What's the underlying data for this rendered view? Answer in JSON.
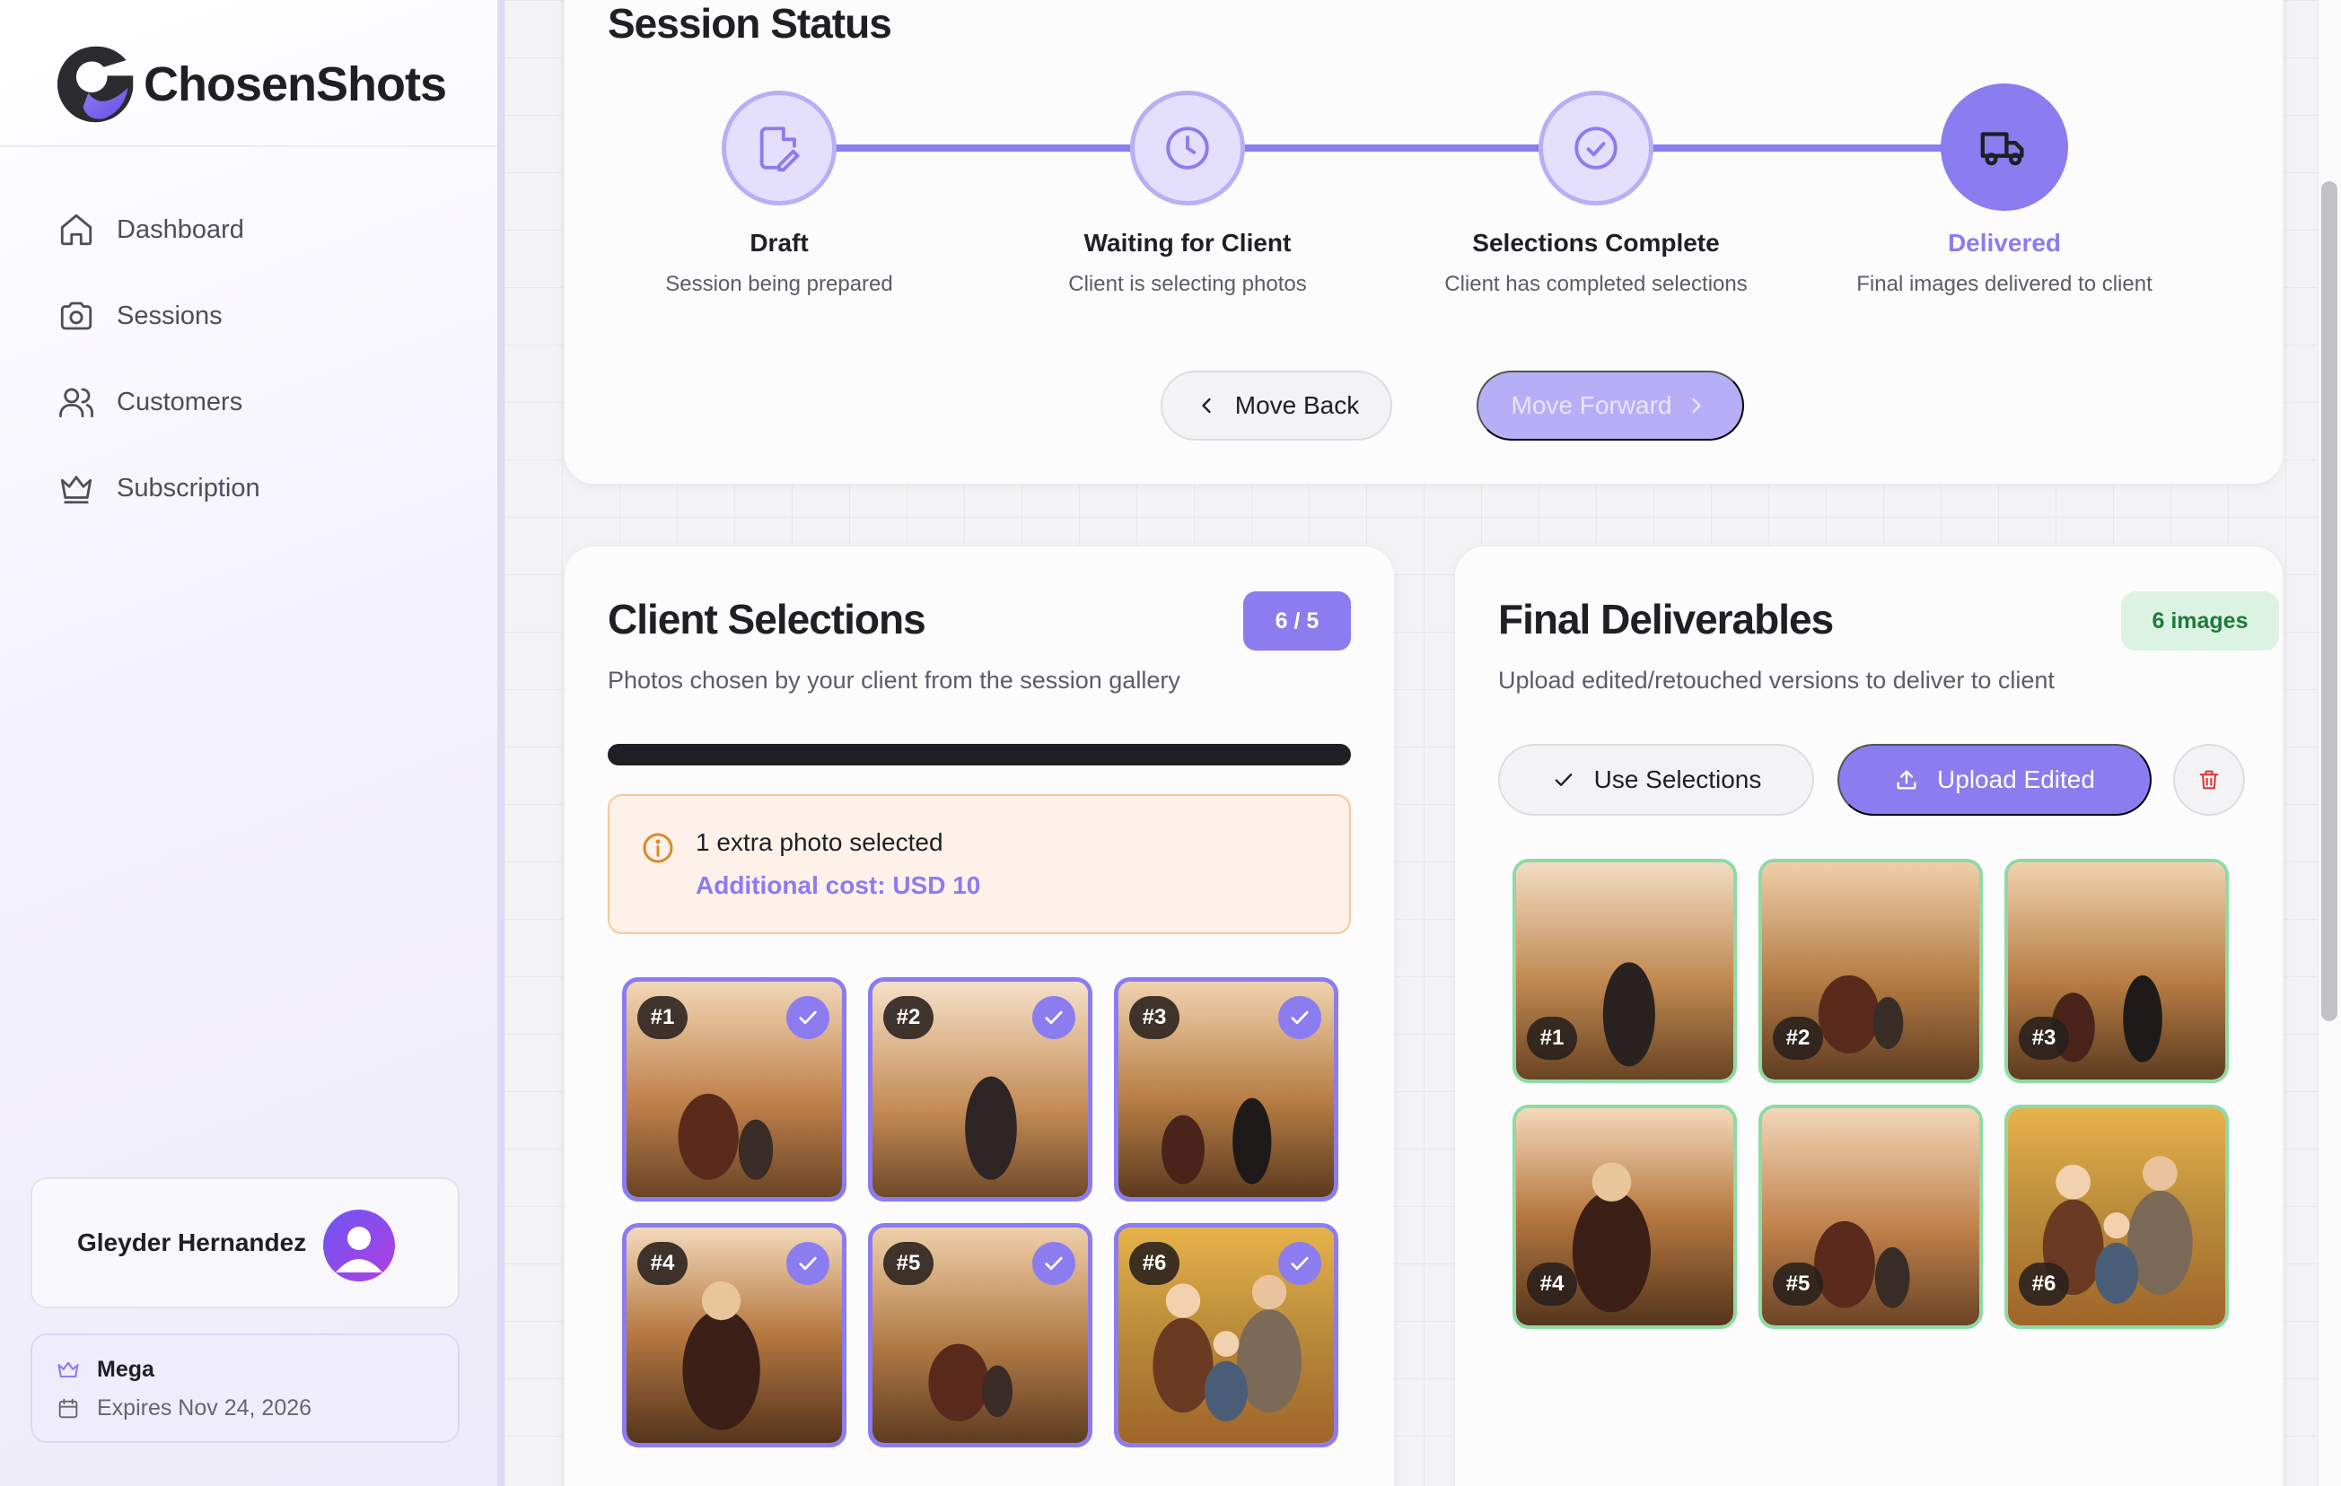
{
  "brand": {
    "name": "ChosenShots"
  },
  "sidebar": {
    "items": [
      {
        "label": "Dashboard",
        "icon": "home-icon"
      },
      {
        "label": "Sessions",
        "icon": "camera-icon"
      },
      {
        "label": "Customers",
        "icon": "users-icon"
      },
      {
        "label": "Subscription",
        "icon": "crown-icon"
      }
    ],
    "user": {
      "name": "Gleyder Hernandez"
    },
    "plan": {
      "name": "Mega",
      "expires": "Expires Nov 24, 2026"
    }
  },
  "status": {
    "title": "Session Status",
    "steps": [
      {
        "title": "Draft",
        "desc": "Session being prepared",
        "icon": "file-edit-icon"
      },
      {
        "title": "Waiting for Client",
        "desc": "Client is selecting photos",
        "icon": "clock-icon"
      },
      {
        "title": "Selections Complete",
        "desc": "Client has completed selections",
        "icon": "check-circle-icon"
      },
      {
        "title": "Delivered",
        "desc": "Final images delivered to client",
        "icon": "truck-icon"
      }
    ],
    "active_step": 3,
    "back_label": "Move Back",
    "forward_label": "Move Forward"
  },
  "selections": {
    "title": "Client Selections",
    "badge": "6 / 5",
    "subtitle": "Photos chosen by your client from the session gallery",
    "progress": 1.0,
    "alert_title": "1 extra photo selected",
    "alert_cost": "Additional cost: USD 10",
    "photos": [
      "#1",
      "#2",
      "#3",
      "#4",
      "#5",
      "#6"
    ]
  },
  "deliverables": {
    "title": "Final Deliverables",
    "badge": "6 images",
    "subtitle": "Upload edited/retouched versions to deliver to client",
    "use_label": "Use Selections",
    "upload_label": "Upload Edited",
    "photos": [
      "#1",
      "#2",
      "#3",
      "#4",
      "#5",
      "#6"
    ]
  },
  "colors": {
    "accent": "#8b7cf0",
    "success": "#1e7a3c",
    "warning": "#f5c99a"
  }
}
